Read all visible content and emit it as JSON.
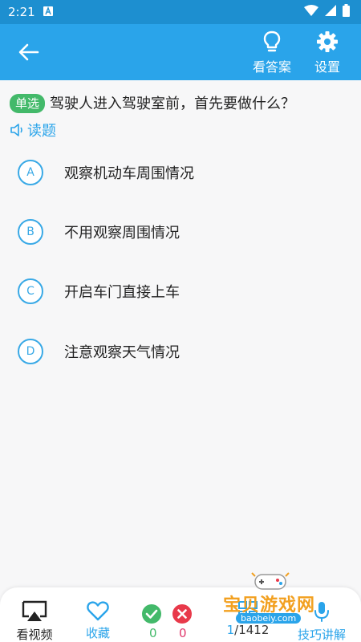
{
  "status_bar": {
    "time": "2:21"
  },
  "app_bar": {
    "view_answer_label": "看答案",
    "settings_label": "设置"
  },
  "question": {
    "type_tag": "单选",
    "text": "驾驶人进入驾驶室前，首先要做什么？",
    "read_label": "读题"
  },
  "options": [
    {
      "letter": "A",
      "text": "观察机动车周围情况"
    },
    {
      "letter": "B",
      "text": "不用观察周围情况"
    },
    {
      "letter": "C",
      "text": "开启车门直接上车"
    },
    {
      "letter": "D",
      "text": "注意观察天气情况"
    }
  ],
  "bottom_bar": {
    "video_label": "看视频",
    "favorite_label": "收藏",
    "correct_count": "0",
    "wrong_count": "0",
    "progress_current": "1",
    "progress_total": "/1412",
    "tips_label": "技巧讲解"
  },
  "watermark": {
    "text": "宝贝游戏网",
    "url": "baobeiy.com"
  },
  "colors": {
    "status_bar": "#1d8fd0",
    "app_bar": "#2aa4ea",
    "accent": "#39a9e6",
    "tag_green": "#43b96a",
    "correct": "#43b96a",
    "wrong": "#e8394a",
    "wrong_count": "#e0366a"
  }
}
